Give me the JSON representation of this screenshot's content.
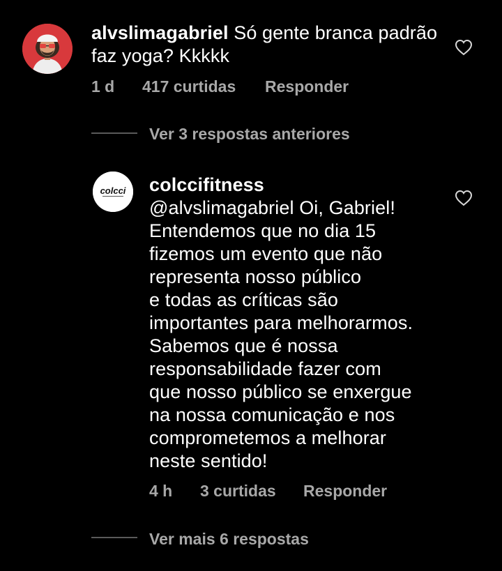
{
  "colors": {
    "background": "#000000",
    "text": "#ffffff",
    "meta": "#a8a8a8",
    "divider": "#5a5a5a",
    "avatar_main_bg": "#d8393c"
  },
  "comment": {
    "username": "alvslimagabriel",
    "text_line1": " Só gente branca padrão",
    "text_line2": "faz yoga? Kkkkk",
    "time": "1 d",
    "likes": "417 curtidas",
    "reply_label": "Responder",
    "like_icon": "heart-outline-icon"
  },
  "thread": {
    "view_previous": "Ver 3 respostas anteriores",
    "view_more": "Ver mais 6 respostas"
  },
  "reply": {
    "username": "colccifitness",
    "avatar_logo": "colcci",
    "mention": "@alvslimagabriel",
    "lines": [
      " Oi, Gabriel!",
      "Entendemos que no dia 15",
      "fizemos um evento que não",
      "representa nosso público",
      "e todas as críticas são",
      "importantes para melhorarmos.",
      "Sabemos que é nossa",
      "responsabilidade fazer com",
      "que nosso público se enxergue",
      "na nossa comunicação e nos",
      "comprometemos a melhorar",
      "neste sentido!"
    ],
    "time": "4 h",
    "likes": "3 curtidas",
    "reply_label": "Responder",
    "like_icon": "heart-outline-icon"
  }
}
